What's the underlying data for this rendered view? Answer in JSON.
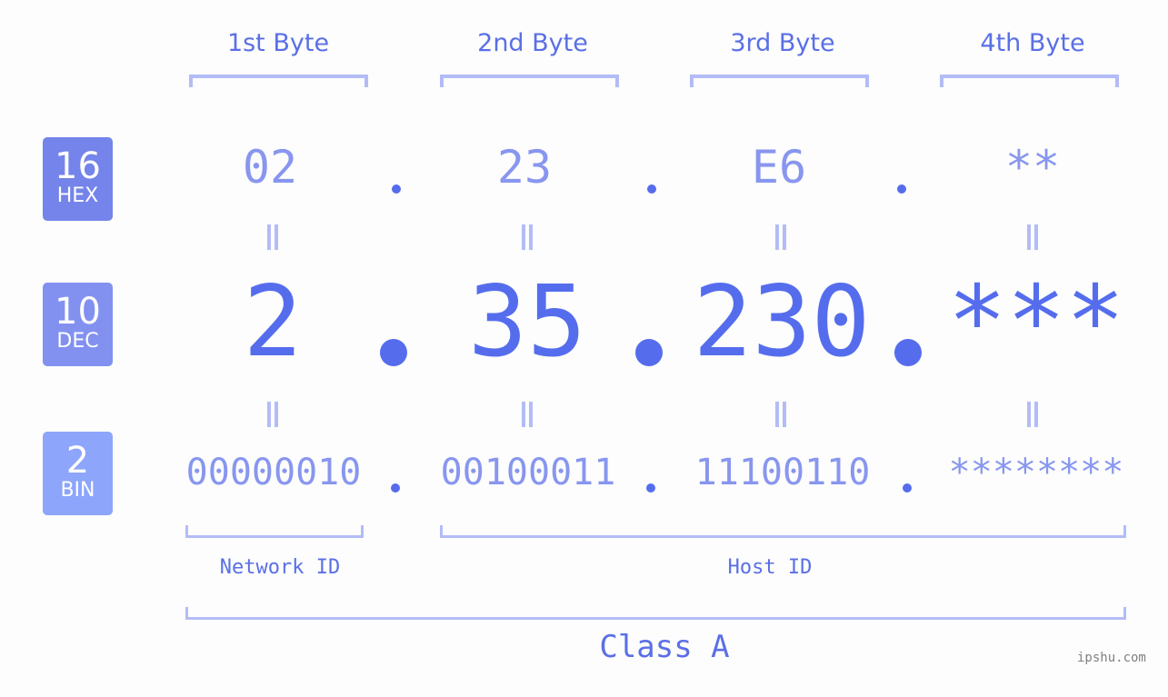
{
  "bytes": [
    {
      "title": "1st Byte",
      "hex": "02",
      "dec": "2",
      "bin": "00000010"
    },
    {
      "title": "2nd Byte",
      "hex": "23",
      "dec": "35",
      "bin": "00100011"
    },
    {
      "title": "3rd Byte",
      "hex": "E6",
      "dec": "230",
      "bin": "11100110"
    },
    {
      "title": "4th Byte",
      "hex": "**",
      "dec": "***",
      "bin": "********"
    }
  ],
  "badges": {
    "hex": {
      "base": "16",
      "label": "HEX",
      "color": "#7484ea"
    },
    "dec": {
      "base": "10",
      "label": "DEC",
      "color": "#8291f0"
    },
    "bin": {
      "base": "2",
      "label": "BIN",
      "color": "#8da5fa"
    }
  },
  "network_id_label": "Network ID",
  "host_id_label": "Host ID",
  "class_label": "Class A",
  "watermark": "ipshu.com",
  "colors": {
    "accent": "#556ded",
    "light_value": "#8896ef",
    "bracket": "#b3bcf7",
    "label": "#5b6fe6"
  }
}
